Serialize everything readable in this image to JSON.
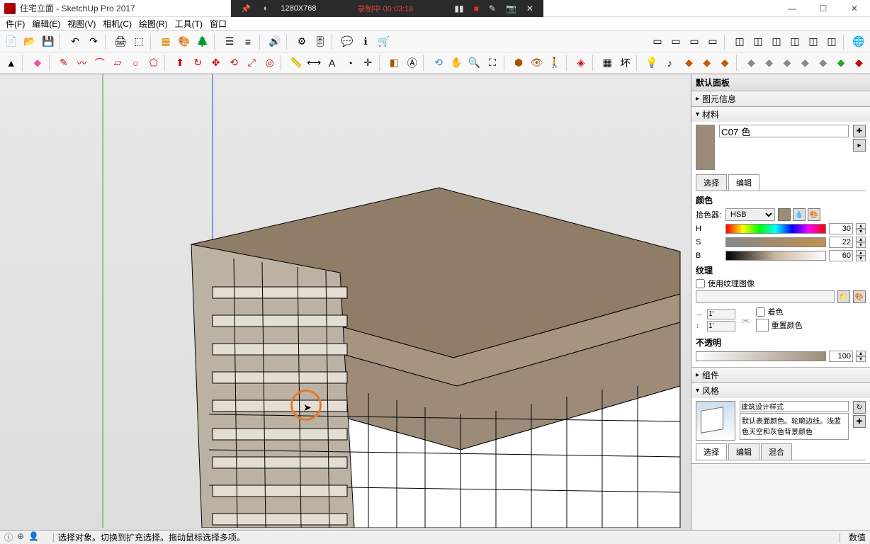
{
  "window": {
    "title": "住宅立面 - SketchUp Pro 2017"
  },
  "recorder": {
    "dim": "1280X768",
    "status": "录制中 00:03:18"
  },
  "menu": {
    "file": "件(F)",
    "edit": "编辑(E)",
    "view": "视图(V)",
    "camera": "相机(C)",
    "draw": "绘图(R)",
    "tools": "工具(T)",
    "window": "窗口"
  },
  "panel": {
    "default_title": "默认面板",
    "entity_info": "图元信息",
    "materials": "材料",
    "material_name": "C07 色",
    "tab_select": "选择",
    "tab_edit": "编辑",
    "color_label": "颜色",
    "picker_label": "拾色器:",
    "picker_mode": "HSB",
    "h_label": "H",
    "s_label": "S",
    "b_label": "B",
    "h_val": "30",
    "s_val": "22",
    "b_val": "60",
    "texture_label": "纹理",
    "use_texture": "使用纹理图像",
    "dim_w": "1'",
    "dim_h": "1'",
    "colorize": "着色",
    "reset_color": "重置颜色",
    "opacity_label": "不透明",
    "opacity_val": "100",
    "components": "组件",
    "styles": "风格",
    "style_name": "建筑设计样式",
    "style_desc": "默认表面颜色。轮廓边线。浅蓝色天空和灰色背景颜色",
    "style_tab_select": "选择",
    "style_tab_edit": "编辑",
    "style_tab_mix": "混合"
  },
  "status": {
    "hint": "选择对象。切换到扩充选择。拖动鼠标选择多项。",
    "measure_label": "数值"
  }
}
